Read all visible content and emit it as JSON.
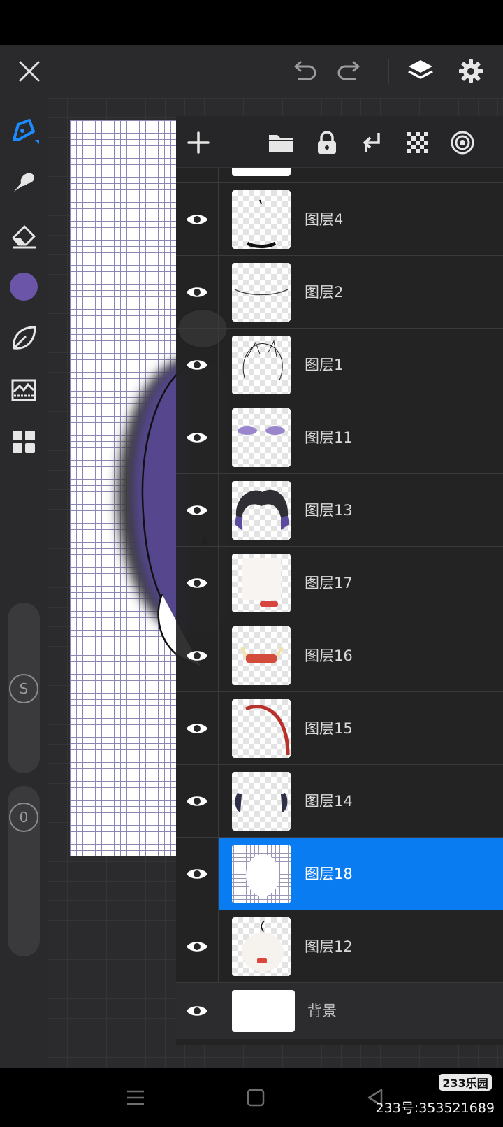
{
  "top_bar": {
    "icons": [
      "close-icon",
      "undo-icon",
      "redo-icon",
      "layers-icon",
      "settings-icon"
    ]
  },
  "left_toolbar": {
    "tools": [
      "pen-tool-icon",
      "smudge-tool-icon",
      "eraser-tool-icon",
      "color-swatch",
      "blend-tool-icon",
      "adjust-tool-icon",
      "gallery-icon"
    ],
    "active_color": "#6b55a8",
    "size_slider_label": "S",
    "opacity_slider_label": "0"
  },
  "layer_panel": {
    "toolbar_icons": [
      "add-layer-icon",
      "folder-icon",
      "lock-icon",
      "merge-down-icon",
      "transparency-icon",
      "layer-effect-icon"
    ],
    "layers": [
      {
        "name": "图层4",
        "visible": true,
        "selected": false
      },
      {
        "name": "图层2",
        "visible": true,
        "selected": false
      },
      {
        "name": "图层1",
        "visible": true,
        "selected": false
      },
      {
        "name": "图层11",
        "visible": true,
        "selected": false
      },
      {
        "name": "图层13",
        "visible": true,
        "selected": false
      },
      {
        "name": "图层17",
        "visible": true,
        "selected": false
      },
      {
        "name": "图层16",
        "visible": true,
        "selected": false
      },
      {
        "name": "图层15",
        "visible": true,
        "selected": false
      },
      {
        "name": "图层14",
        "visible": true,
        "selected": false
      },
      {
        "name": "图层18",
        "visible": true,
        "selected": true
      },
      {
        "name": "图层12",
        "visible": true,
        "selected": false
      }
    ],
    "background_layer": {
      "name": "背景",
      "visible": true
    },
    "selected_color": "#0a7cf2"
  },
  "nav_bar": {
    "icons": [
      "menu-icon",
      "home-icon",
      "back-icon"
    ]
  },
  "watermark": {
    "logo": "233乐园",
    "id_text": "233号:353521689"
  }
}
